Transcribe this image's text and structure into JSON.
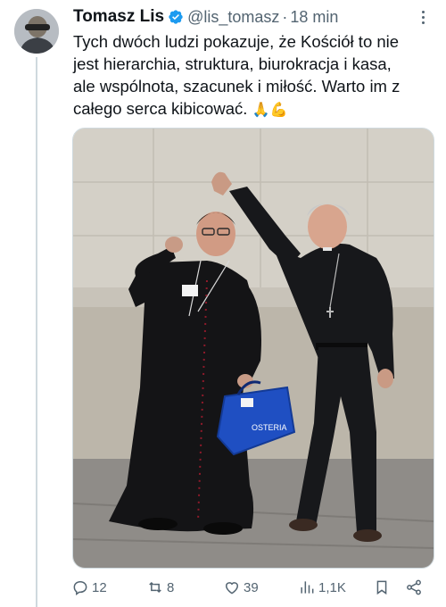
{
  "tweet": {
    "author_name": "Tomasz Lis",
    "handle": "@lis_tomasz",
    "separator": "·",
    "time": "18 min",
    "text_lines": [
      "Tych dwóch ludzi pokazuje, że Kościół to nie",
      "jest hierarchia, struktura, biurokracja i kasa,",
      "ale wspólnota, szacunek i miłość. Warto im z",
      "całego serca kibicować."
    ],
    "emojis": "🙏💪",
    "bag_logo_text": "OSTERIA"
  },
  "actions": {
    "replies": "12",
    "reposts": "8",
    "likes": "39",
    "views": "1,1K"
  },
  "icons": {
    "verified": "verified-badge-icon",
    "more": "more-options-icon",
    "reply": "reply-icon",
    "repost": "repost-icon",
    "like": "like-icon",
    "views": "views-icon",
    "bookmark": "bookmark-icon",
    "share": "share-icon"
  },
  "colors": {
    "verified_blue": "#1d9bf0",
    "text_primary": "#0f1419",
    "text_secondary": "#536471"
  }
}
